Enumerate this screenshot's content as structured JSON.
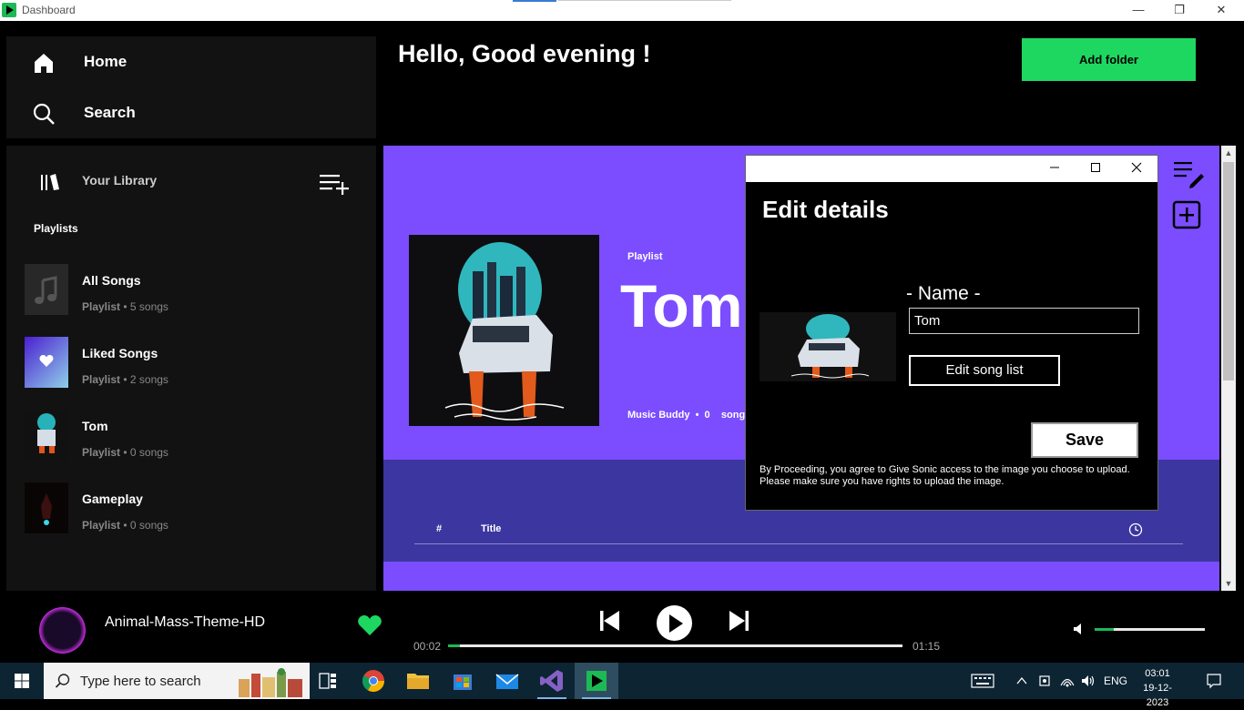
{
  "window": {
    "title": "Dashboard",
    "min": "—",
    "restore": "❐",
    "close": "✕"
  },
  "nav": {
    "home": "Home",
    "search": "Search"
  },
  "library": {
    "label": "Your Library",
    "section": "Playlists",
    "playlists": [
      {
        "name": "All Songs",
        "kind": "Playlist",
        "count": "5 songs"
      },
      {
        "name": "Liked Songs",
        "kind": "Playlist",
        "count": "2 songs"
      },
      {
        "name": "Tom",
        "kind": "Playlist",
        "count": "0 songs"
      },
      {
        "name": "Gameplay",
        "kind": "Playlist",
        "count": "0 songs"
      }
    ]
  },
  "header": {
    "greeting": "Hello, Good evening !",
    "add_folder": "Add folder"
  },
  "playlist_view": {
    "type": "Playlist",
    "title": "Tom",
    "owner": "Music Buddy",
    "song_count": "0",
    "songs_word": "songs",
    "col_num": "#",
    "col_title": "Title"
  },
  "dialog": {
    "title": "Edit details",
    "name_label": "- Name -",
    "name_value": "Tom",
    "edit_song_list": "Edit song list",
    "save": "Save",
    "disclaimer": "By Proceeding, you agree to Give Sonic access to the image you choose to upload. Please make sure you have rights to upload the image."
  },
  "player": {
    "track": "Animal-Mass-Theme-HD",
    "time_current": "00:02",
    "time_total": "01:15",
    "progress": 0.027,
    "volume": 0.17
  },
  "taskbar": {
    "search_placeholder": "Type here to search",
    "lang": "ENG",
    "time": "03:01",
    "date": "19-12-2023"
  },
  "colors": {
    "accent": "#1ed760",
    "playlist_bg": "#7b4dff",
    "tracks_bg": "#3c36a0"
  }
}
